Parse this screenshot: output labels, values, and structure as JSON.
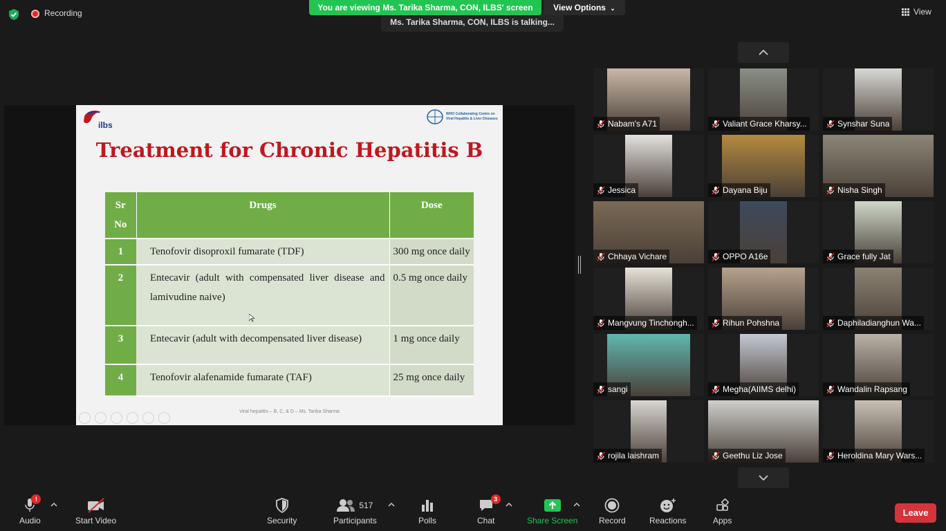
{
  "topbar": {
    "recording_label": "Recording",
    "banner_text": "You are viewing Ms. Tarika Sharma, CON, ILBS' screen",
    "view_options_label": "View Options",
    "talking_text": "Ms. Tarika Sharma, CON, ILBS is talking...",
    "view_label": "View"
  },
  "slide": {
    "logo_text": "ilbs",
    "who_text_line1": "WHO Collaborating Centre on",
    "who_text_line2": "Viral Hepatitis & Liver Diseases",
    "title": "Treatment for Chronic Hepatitis B",
    "table": {
      "headers": [
        "Sr No",
        "Drugs",
        "Dose"
      ],
      "rows": [
        {
          "sr": "1",
          "drug": "Tenofovir disoproxil fumarate (TDF)",
          "dose": "300 mg once daily"
        },
        {
          "sr": "2",
          "drug": "Entecavir (adult with compensated liver disease and lamivudine naive)",
          "dose": "0.5 mg once daily"
        },
        {
          "sr": "3",
          "drug": "Entecavir (adult with decompensated liver disease)",
          "dose": "1 mg once daily"
        },
        {
          "sr": "4",
          "drug": "Tenofovir alafenamide fumarate (TAF)",
          "dose": "25 mg once daily"
        }
      ]
    },
    "footer": "Viral hepatitis – B, C, & D – Ms. Tarika Sharma"
  },
  "participants": [
    {
      "name": "Nabam's A71",
      "color": "#c9b8a8"
    },
    {
      "name": "Valiant Grace Kharsy...",
      "color": "#8a8f86"
    },
    {
      "name": "Synshar Suna",
      "color": "#d8d8d4"
    },
    {
      "name": "Jessica",
      "color": "#e4e2df"
    },
    {
      "name": "Dayana Biju",
      "color": "#b58a3e"
    },
    {
      "name": "Nisha Singh",
      "color": "#8c8677"
    },
    {
      "name": "Chhaya Vichare",
      "color": "#7a6a55"
    },
    {
      "name": "OPPO A16e",
      "color": "#3d4a5c"
    },
    {
      "name": "Grace fully Jat",
      "color": "#cfd8c8"
    },
    {
      "name": "Mangvung Tinchongh...",
      "color": "#e6e2d8"
    },
    {
      "name": "Rihun Pohshna",
      "color": "#b7a28d"
    },
    {
      "name": "Daphiladianghun Wa...",
      "color": "#8c8272"
    },
    {
      "name": "sangi",
      "color": "#5fb8b0"
    },
    {
      "name": "Megha(AIIMS delhi)",
      "color": "#c4c8d4"
    },
    {
      "name": "Wandalin Rapsang",
      "color": "#b9b2a7"
    },
    {
      "name": "rojila laishram",
      "color": "#d9d6d2"
    },
    {
      "name": "Geethu Liz Jose",
      "color": "#cfcfcc"
    },
    {
      "name": "Heroldina Mary Wars...",
      "color": "#c9c1b6"
    }
  ],
  "toolbar": {
    "audio_label": "Audio",
    "audio_badge": "!",
    "video_label": "Start Video",
    "security_label": "Security",
    "participants_label": "Participants",
    "participants_count": "517",
    "polls_label": "Polls",
    "chat_label": "Chat",
    "chat_badge": "3",
    "share_label": "Share Screen",
    "record_label": "Record",
    "reactions_label": "Reactions",
    "apps_label": "Apps",
    "leave_label": "Leave"
  },
  "colors": {
    "share_green": "#23c552",
    "leave_red": "#d5353a",
    "slide_title_red": "#c0181f",
    "table_green": "#70ad47"
  }
}
